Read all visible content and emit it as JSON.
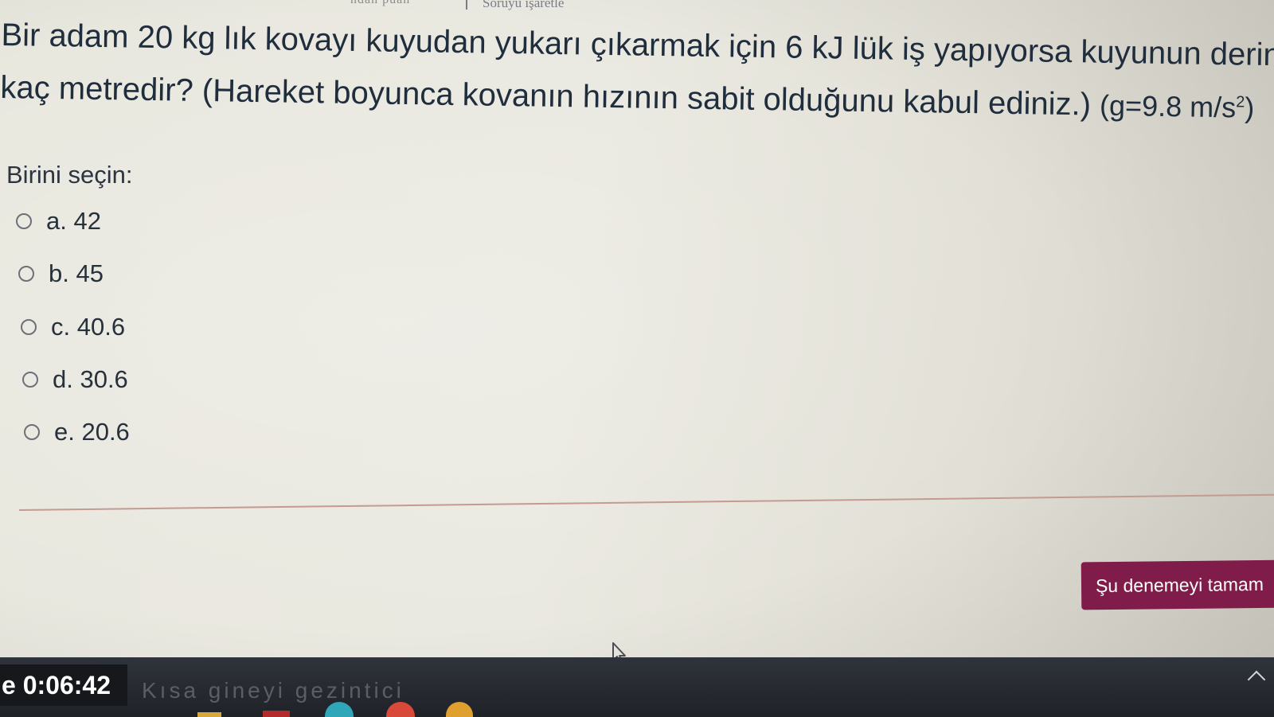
{
  "header": {
    "left_text": "ndan puan",
    "flag_label": "Soruyu işaretle"
  },
  "question": {
    "line1": "Bir adam 20 kg lık kovayı kuyudan yukarı çıkarmak için 6 kJ lük iş yapıyorsa kuyunun derin",
    "line2_text": "kaç metredir? (Hareket boyunca kovanın hızının sabit olduğunu kabul ediniz.)",
    "formula_base": "(g=9.8 m/s",
    "formula_exp": "2",
    "formula_close": ")"
  },
  "prompt": "Birini seçin:",
  "options": [
    {
      "label": "a. 42",
      "selected": false
    },
    {
      "label": "b. 45",
      "selected": false
    },
    {
      "label": "c. 40.6",
      "selected": false
    },
    {
      "label": "d. 30.6",
      "selected": false
    },
    {
      "label": "e. 20.6",
      "selected": false
    }
  ],
  "finish_button": {
    "label": "Şu denemeyi tamam",
    "color": "#7f1c4a"
  },
  "timer": {
    "prefix": "e",
    "value": "0:06:42"
  },
  "taskbar": {
    "search_hint": "Kısa gineyi gezintici",
    "icons": [
      "file-explorer-icon",
      "office-icon",
      "edge-icon",
      "chrome-icon",
      "app-icon"
    ]
  }
}
